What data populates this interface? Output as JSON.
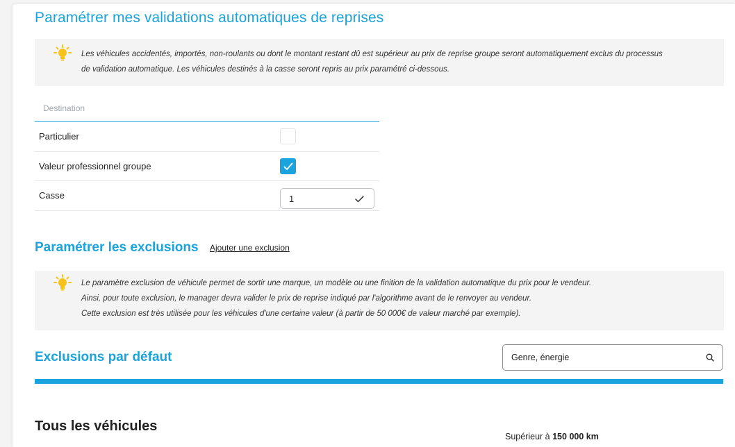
{
  "title": "Paramétrer mes validations automatiques de reprises",
  "info1": {
    "line1": "Les véhicules accidentés, importés, non-roulants ou dont le montant restant dû est supérieur au prix de reprise groupe seront automatiquement exclus du processus",
    "line2": "de validation automatique. Les véhicules destinés à la casse seront repris au prix paramétré ci-dessous."
  },
  "destinations": {
    "header": "Destination",
    "rows": [
      {
        "label": "Particulier",
        "type": "checkbox",
        "checked": false
      },
      {
        "label": "Valeur professionnel groupe",
        "type": "checkbox",
        "checked": true
      },
      {
        "label": "Casse",
        "type": "input",
        "value": "1"
      }
    ]
  },
  "exclusions": {
    "title": "Paramétrer les exclusions",
    "add_link": "Ajouter une exclusion",
    "info": {
      "line1": "Le paramètre exclusion de véhicule permet de sortir une marque, un modèle ou une finition de la validation automatique du prix pour le vendeur.",
      "line2": "Ainsi, pour toute exclusion, le manager devra valider le prix de reprise indiqué par l'algorithme avant de le renvoyer au vendeur.",
      "line3": "Cette exclusion est très utilisée pour les véhicules d'une certaine valeur (à partir de 50 000€ de valeur marché par exemple)."
    }
  },
  "default_exclusions": {
    "title": "Exclusions par défaut",
    "search_value": "Genre, énergie",
    "search_icon": "search-icon"
  },
  "vehicles": {
    "title": "Tous les véhicules",
    "km_prefix": "Supérieur à",
    "km_value": "150 000 km"
  },
  "colors": {
    "accent": "#1aa3dc",
    "bulb": "#f7c31a",
    "info_bg": "#f4f4f4"
  }
}
